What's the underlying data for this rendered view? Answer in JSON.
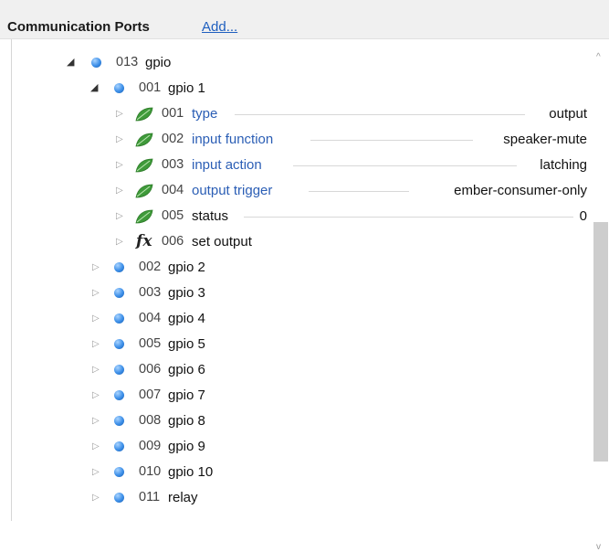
{
  "header": {
    "title": "Communication Ports",
    "add_link": "Add..."
  },
  "tree": {
    "gpio_root": {
      "num": "013",
      "name": "gpio"
    },
    "gpio1": {
      "num": "001",
      "name": "gpio 1"
    },
    "params": [
      {
        "num": "001",
        "name": "type",
        "value": "output",
        "icon": "leaf-icon"
      },
      {
        "num": "002",
        "name": "input function",
        "value": "speaker-mute",
        "icon": "leaf-icon"
      },
      {
        "num": "003",
        "name": "input action",
        "value": "latching",
        "icon": "leaf-icon"
      },
      {
        "num": "004",
        "name": "output trigger",
        "value": "ember-consumer-only",
        "icon": "leaf-icon"
      },
      {
        "num": "005",
        "name": "status",
        "value": "0",
        "icon": "leaf-icon"
      }
    ],
    "function": {
      "num": "006",
      "name": "set output",
      "icon": "fx-icon"
    },
    "nodes": [
      {
        "num": "002",
        "name": "gpio 2"
      },
      {
        "num": "003",
        "name": "gpio 3"
      },
      {
        "num": "004",
        "name": "gpio 4"
      },
      {
        "num": "005",
        "name": "gpio 5"
      },
      {
        "num": "006",
        "name": "gpio 6"
      },
      {
        "num": "007",
        "name": "gpio 7"
      },
      {
        "num": "008",
        "name": "gpio 8"
      },
      {
        "num": "009",
        "name": "gpio 9"
      },
      {
        "num": "010",
        "name": "gpio 10"
      },
      {
        "num": "011",
        "name": "relay"
      }
    ],
    "glyphs": {
      "expanded": "◢",
      "collapsed": "▷",
      "fx": "fx",
      "scroll_up": "^",
      "scroll_down": "v"
    }
  }
}
